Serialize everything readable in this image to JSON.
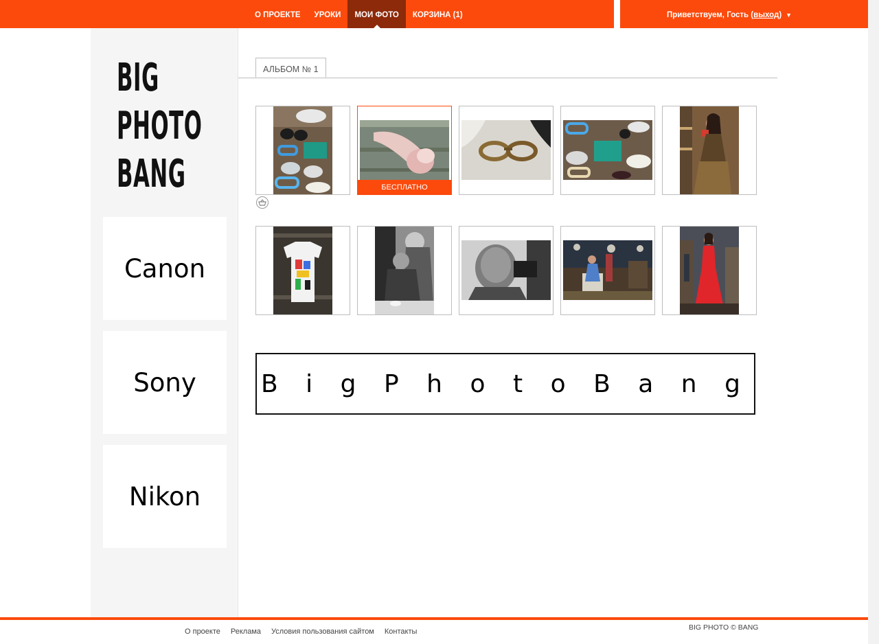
{
  "nav": {
    "items": [
      {
        "label": "О ПРОЕКТЕ",
        "active": false
      },
      {
        "label": "УРОКИ",
        "active": false
      },
      {
        "label": "МОИ ФОТО",
        "active": true
      },
      {
        "label": "КОРЗИНА (1)",
        "active": false
      }
    ],
    "greeting_prefix": "Приветствуем, Гость (",
    "logout_label": "выход",
    "greeting_suffix": ")",
    "caret": "▼"
  },
  "colors": {
    "accent": "#fb4a0c",
    "nav_active": "#8c2a0a"
  },
  "sidebar": {
    "logo_lines": [
      "BIG",
      "PHOTO",
      "BANG"
    ],
    "brands": [
      "Canon",
      "Sony",
      "Nikon"
    ]
  },
  "album": {
    "tab_label": "АЛЬБОМ № 1",
    "free_label": "БЕСПЛАТНО",
    "photos": [
      {
        "subject": "sunglasses flat lay"
      },
      {
        "subject": "pink fur slippers",
        "selected": true,
        "free": true
      },
      {
        "subject": "tortoiseshell glasses"
      },
      {
        "subject": "sunglasses flat lay"
      },
      {
        "subject": "woman in leopard dress"
      },
      {
        "subject": "printed t-shirt"
      },
      {
        "subject": "two men at table"
      },
      {
        "subject": "man portrait"
      },
      {
        "subject": "woman in showroom"
      },
      {
        "subject": "woman in red dress"
      }
    ]
  },
  "basket_icon": "basket-icon",
  "banner": {
    "letters": [
      "B",
      "i",
      "g",
      "P",
      "h",
      "o",
      "t",
      "o",
      "B",
      "a",
      "n",
      "g"
    ]
  },
  "footer": {
    "links": [
      "О проекте",
      "Реклама",
      "Условия пользования сайтом",
      "Контакты"
    ],
    "copyright": "BIG PHOTO © BANG"
  }
}
